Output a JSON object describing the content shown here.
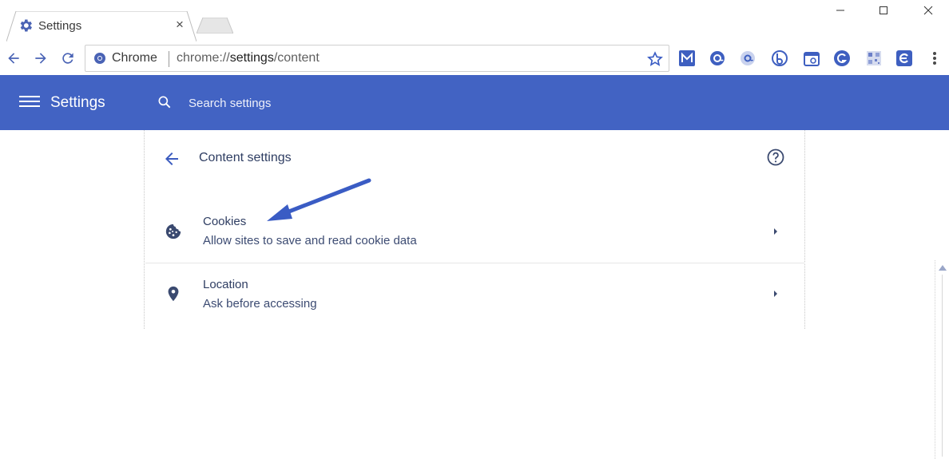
{
  "tab": {
    "title": "Settings",
    "close_glyph": "×"
  },
  "omnibox": {
    "site_label": "Chrome",
    "url_prefix": "chrome://",
    "url_host": "settings",
    "url_path": "/content"
  },
  "header": {
    "title": "Settings",
    "search_placeholder": "Search settings"
  },
  "page": {
    "title": "Content settings",
    "items": [
      {
        "title": "Cookies",
        "subtitle": "Allow sites to save and read cookie data",
        "icon": "cookie-icon"
      },
      {
        "title": "Location",
        "subtitle": "Ask before accessing",
        "icon": "location-pin-icon"
      }
    ]
  },
  "extensions": [
    "mailtrack-icon",
    "at-sign-icon",
    "anonymox-icon",
    "bitly-icon",
    "calendar-icon",
    "grammarly-icon",
    "qr-icon",
    "cleaner-icon"
  ],
  "colors": {
    "header_bg": "#4263c3",
    "accent": "#3b5bbf",
    "annotation": "#3a5cc4"
  }
}
